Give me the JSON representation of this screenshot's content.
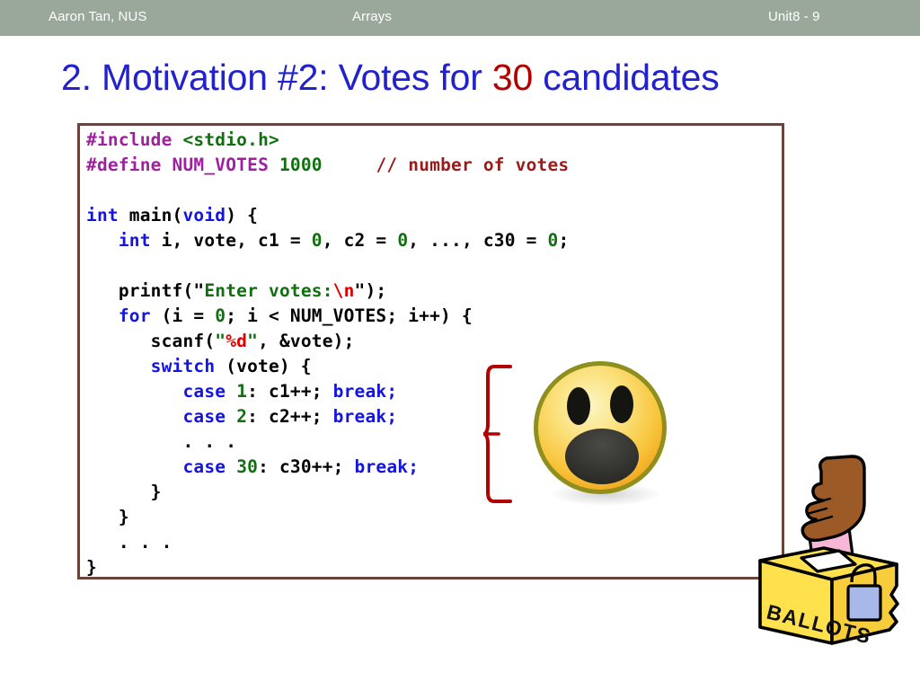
{
  "header": {
    "author": "Aaron Tan, NUS",
    "topic": "Arrays",
    "unit": "Unit8 - 9",
    "bar_color": "#9aa89b",
    "text_color": "#ffffff"
  },
  "title": {
    "prefix": "2. Motivation #2: Votes for ",
    "accent": "30",
    "suffix": " candidates",
    "color": "#2222cc",
    "accent_color": "#b30000"
  },
  "code": {
    "border_color": "#6b4438",
    "language": "C",
    "lines": [
      "#include <stdio.h>",
      "#define NUM_VOTES 1000     // number of votes",
      "",
      "int main(void) {",
      "   int i, vote, c1 = 0, c2 = 0, ..., c30 = 0;",
      "",
      "   printf(\"Enter votes:\\n\");",
      "   for (i = 0; i < NUM_VOTES; i++) {",
      "      scanf(\"%d\", &vote);",
      "      switch (vote) {",
      "         case 1: c1++; break;",
      "         case 2: c2++; break;",
      "         . . .",
      "         case 30: c30++; break;",
      "      }",
      "   }",
      "   . . .",
      "}"
    ],
    "syntax_colors": {
      "preprocessor": "#a020a0",
      "string": "#107010",
      "number": "#107010",
      "comment": "#9b1b1b",
      "keyword": "#1414e0",
      "escape": "#e00000",
      "plain": "#000000"
    }
  },
  "annotations": {
    "brace_color": "#b00000",
    "brace_label": "switch-cases-group-brace"
  },
  "artwork": {
    "face": {
      "name": "shocked-face-emoji",
      "fill_light": "#fdf0a8",
      "fill_mid": "#f8c842",
      "fill_dark": "#f0a020",
      "rim": "#8f8f1e",
      "feature": "#1a1a1a"
    },
    "ballot": {
      "name": "ballot-box-illustration",
      "label": "BALLOTS",
      "box_face": "#ffe14d",
      "box_side": "#f5c842",
      "hand": "#9c5a26",
      "paper": "#f7b8d8",
      "lock": "#a8b8e8",
      "outline": "#000000"
    }
  }
}
